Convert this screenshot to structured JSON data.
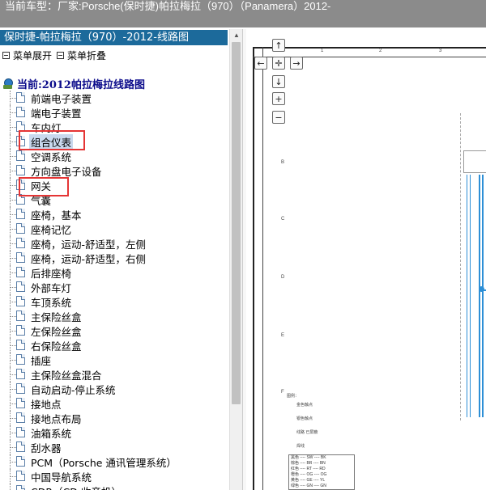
{
  "header": {
    "title": "当前车型：厂家:Porsche(保时捷)帕拉梅拉（970）（Panamera）2012-"
  },
  "left_pane": {
    "title": "保时捷-帕拉梅拉（970）-2012-线路图",
    "expand_label": "菜单展开",
    "collapse_label": "菜单折叠",
    "root_label": "当前:2012帕拉梅拉线路图",
    "items": [
      {
        "label": "前端电子装置"
      },
      {
        "label": "端电子装置"
      },
      {
        "label": "车内灯"
      },
      {
        "label": "组合仪表",
        "selected": true
      },
      {
        "label": "空调系统"
      },
      {
        "label": "方向盘电子设备"
      },
      {
        "label": "网关"
      },
      {
        "label": "气囊"
      },
      {
        "label": "座椅，基本"
      },
      {
        "label": "座椅记忆"
      },
      {
        "label": "座椅，运动-舒适型，左侧"
      },
      {
        "label": "座椅，运动-舒适型，右侧"
      },
      {
        "label": "后排座椅"
      },
      {
        "label": "外部车灯"
      },
      {
        "label": "车顶系统"
      },
      {
        "label": "主保险丝盒"
      },
      {
        "label": "左保险丝盒"
      },
      {
        "label": "右保险丝盒"
      },
      {
        "label": "插座"
      },
      {
        "label": "主保险丝盒混合"
      },
      {
        "label": "自动启动-停止系统"
      },
      {
        "label": "接地点"
      },
      {
        "label": "接地点布局"
      },
      {
        "label": "油箱系统"
      },
      {
        "label": "刮水器"
      },
      {
        "label": "PCM（Porsche 通讯管理系统）"
      },
      {
        "label": "中国导航系统"
      },
      {
        "label": "CDR（CD 收音机）"
      }
    ]
  },
  "diagram": {
    "ruler_top": [
      "1",
      "2",
      "3"
    ],
    "ruler_left": [
      "B",
      "C",
      "D",
      "E",
      "F"
    ],
    "legend_title": "图例：",
    "legend_items": [
      "金色触点",
      "银色触点",
      "线路 已屏蔽",
      "焊线"
    ],
    "color_table": [
      "黑色 ---- SW ---- BK",
      "棕色 ---- BR ---- BN",
      "红色 ---- RT ---- RD",
      "橙色 ---- OG ---- OG",
      "黄色 ---- GE ---- YL",
      "绿色 ---- GN ---- GN"
    ]
  },
  "nav_buttons": {
    "up": "↑",
    "left": "←",
    "center": "✛",
    "right": "→",
    "down": "↓",
    "zoom_in": "+",
    "zoom_out": "−"
  },
  "colors": {
    "title_bar": "#1c6a9b",
    "header_bg": "#8b8b8b",
    "highlight_box": "#e53535",
    "wire": "#2d8fd6"
  }
}
